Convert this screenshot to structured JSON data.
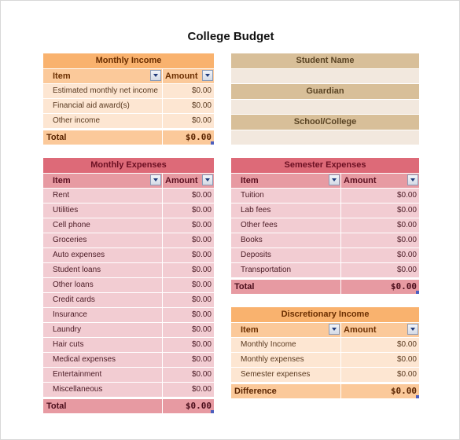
{
  "title": "College Budget",
  "info": {
    "fields": [
      {
        "label": "Student Name",
        "value": ""
      },
      {
        "label": "Guardian",
        "value": ""
      },
      {
        "label": "School/College",
        "value": ""
      }
    ]
  },
  "monthly_income": {
    "caption": "Monthly Income",
    "col_item": "Item",
    "col_amount": "Amount",
    "rows": [
      {
        "item": "Estimated monthly net income",
        "amount": "$0.00"
      },
      {
        "item": "Financial aid award(s)",
        "amount": "$0.00"
      },
      {
        "item": "Other income",
        "amount": "$0.00"
      }
    ],
    "total_label": "Total",
    "total_value": "$0.00"
  },
  "monthly_expenses": {
    "caption": "Monthly Expenses",
    "col_item": "Item",
    "col_amount": "Amount",
    "rows": [
      {
        "item": "Rent",
        "amount": "$0.00"
      },
      {
        "item": "Utilities",
        "amount": "$0.00"
      },
      {
        "item": "Cell phone",
        "amount": "$0.00"
      },
      {
        "item": "Groceries",
        "amount": "$0.00"
      },
      {
        "item": "Auto expenses",
        "amount": "$0.00"
      },
      {
        "item": "Student loans",
        "amount": "$0.00"
      },
      {
        "item": "Other loans",
        "amount": "$0.00"
      },
      {
        "item": "Credit cards",
        "amount": "$0.00"
      },
      {
        "item": "Insurance",
        "amount": "$0.00"
      },
      {
        "item": "Laundry",
        "amount": "$0.00"
      },
      {
        "item": "Hair cuts",
        "amount": "$0.00"
      },
      {
        "item": "Medical expenses",
        "amount": "$0.00"
      },
      {
        "item": "Entertainment",
        "amount": "$0.00"
      },
      {
        "item": "Miscellaneous",
        "amount": "$0.00"
      }
    ],
    "total_label": "Total",
    "total_value": "$0.00"
  },
  "semester_expenses": {
    "caption": "Semester Expenses",
    "col_item": "Item",
    "col_amount": "Amount",
    "rows": [
      {
        "item": "Tuition",
        "amount": "$0.00"
      },
      {
        "item": "Lab fees",
        "amount": "$0.00"
      },
      {
        "item": "Other fees",
        "amount": "$0.00"
      },
      {
        "item": "Books",
        "amount": "$0.00"
      },
      {
        "item": "Deposits",
        "amount": "$0.00"
      },
      {
        "item": "Transportation",
        "amount": "$0.00"
      }
    ],
    "total_label": "Total",
    "total_value": "$0.00"
  },
  "discretionary_income": {
    "caption": "Discretionary Income",
    "col_item": "Item",
    "col_amount": "Amount",
    "rows": [
      {
        "item": "Monthly Income",
        "amount": "$0.00"
      },
      {
        "item": "Monthly expenses",
        "amount": "$0.00"
      },
      {
        "item": "Semester expenses",
        "amount": "$0.00"
      }
    ],
    "total_label": "Difference",
    "total_value": "$0.00"
  },
  "icons": {
    "filter_dropdown": "filter-dropdown-icon",
    "resize_handle": "table-resize-handle-icon"
  },
  "colors": {
    "income_caption": "#f9b26e",
    "income_row": "#fde6d2",
    "expense_caption": "#dd6a78",
    "expense_row": "#f2ccd2",
    "info_label": "#d8bf99",
    "info_value": "#f2e8de"
  }
}
